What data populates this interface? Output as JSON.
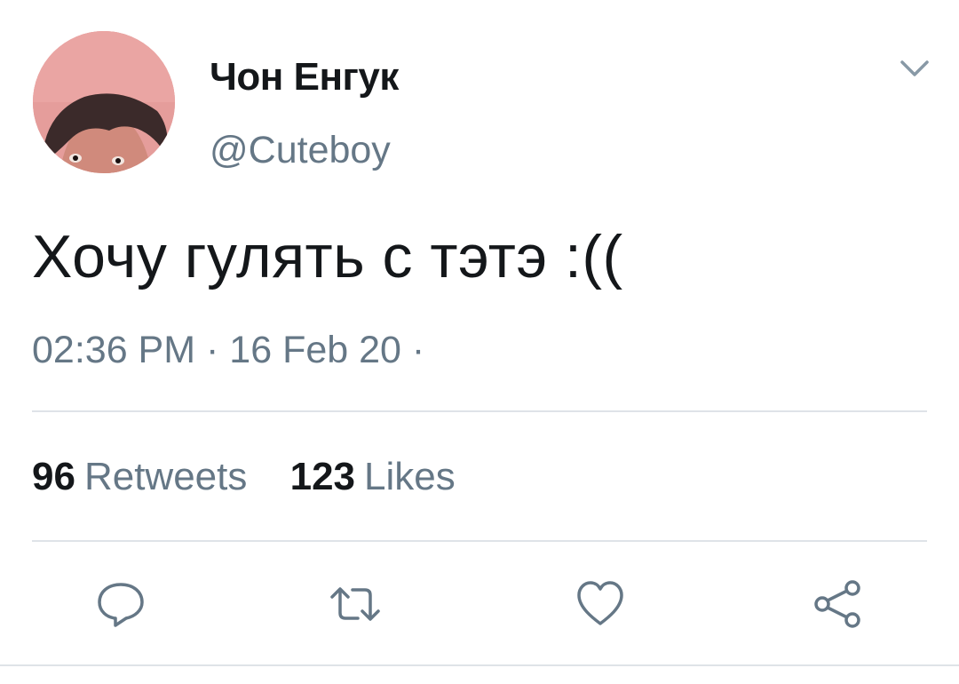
{
  "tweet": {
    "display_name": "Чон Енгук",
    "handle": "@Cuteboy",
    "text": "Хочу гулять с тэтэ :((",
    "time": "02:36 PM",
    "date": "16 Feb 20",
    "separator": "·"
  },
  "stats": {
    "retweets_count": "96",
    "retweets_label": "Retweets",
    "likes_count": "123",
    "likes_label": "Likes"
  },
  "icons": {
    "caret": "chevron-down-icon",
    "reply": "reply-icon",
    "retweet": "retweet-icon",
    "like": "heart-icon",
    "share": "share-icon"
  },
  "colors": {
    "text_primary": "#14171a",
    "text_secondary": "#657786",
    "divider": "#dfe3e8",
    "icon": "#657786"
  }
}
